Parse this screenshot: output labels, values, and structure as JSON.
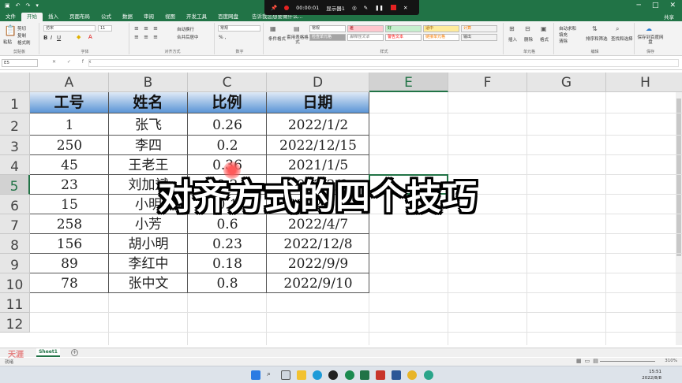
{
  "titlebar": {
    "window_controls": [
      "─",
      "□",
      "✕"
    ]
  },
  "recorder": {
    "time": "00:00:01",
    "display": "显示器1"
  },
  "menu": {
    "tabs": [
      "文件",
      "开始",
      "插入",
      "页面布局",
      "公式",
      "数据",
      "审阅",
      "视图",
      "开发工具",
      "百度网盘"
    ],
    "active_tab": "开始",
    "tell_me": "告诉我您想要做什么...",
    "share": "共享"
  },
  "ribbon": {
    "clipboard": {
      "paste": "粘贴",
      "cut": "剪切",
      "copy": "复制",
      "format_painter": "格式刷",
      "label": "剪贴板"
    },
    "font": {
      "name": "仿宋",
      "size": "11",
      "label": "字体"
    },
    "alignment": {
      "wrap": "自动换行",
      "merge": "合并后居中",
      "label": "对齐方式"
    },
    "number": {
      "format": "常规",
      "label": "数字"
    },
    "styles": {
      "conditional": "条件格式",
      "table": "套用表格格式",
      "cells": [
        "常规",
        "差",
        "好",
        "适中",
        "计算",
        "检查单元格",
        "解释性文本",
        "警告文本",
        "链接单元格",
        "输出"
      ],
      "label": "样式"
    },
    "cells_group": {
      "insert": "插入",
      "delete": "删除",
      "format": "格式",
      "label": "单元格"
    },
    "editing": {
      "autosum": "自动求和",
      "fill": "填充",
      "clear": "清除",
      "sort": "排序和筛选",
      "find": "查找和选择",
      "label": "编辑"
    },
    "save": {
      "label": "保存到百度网盘",
      "group": "保存"
    },
    "colors": {
      "accent": "#217346",
      "header_top": "#dfe9f6",
      "header_bottom": "#5b95d6",
      "good": "#c6efce",
      "bad": "#ffc7ce",
      "neutral": "#ffeb9c"
    }
  },
  "formula_bar": {
    "name_box": "E5",
    "fx_icons": "✕ ✓ fx",
    "value": ""
  },
  "grid": {
    "columns": [
      "A",
      "B",
      "C",
      "D",
      "E",
      "F",
      "G",
      "H"
    ],
    "rows": [
      "1",
      "2",
      "3",
      "4",
      "5",
      "6",
      "7",
      "8",
      "9",
      "10",
      "11",
      "12"
    ],
    "selected_cell": "E5",
    "table": {
      "headers": [
        "工号",
        "姓名",
        "比例",
        "日期"
      ],
      "rows": [
        [
          "1",
          "张飞",
          "0.26",
          "2022/1/2"
        ],
        [
          "250",
          "李四",
          "0.2",
          "2022/12/15"
        ],
        [
          "45",
          "王老王",
          "0.36",
          "2021/1/5"
        ],
        [
          "23",
          "刘加斌",
          "0.2",
          "2022/2/9"
        ],
        [
          "15",
          "小明",
          "0.1",
          "2022/9/6"
        ],
        [
          "258",
          "小芳",
          "0.6",
          "2022/4/7"
        ],
        [
          "156",
          "胡小明",
          "0.23",
          "2022/12/8"
        ],
        [
          "89",
          "李红中",
          "0.18",
          "2022/9/9"
        ],
        [
          "78",
          "张中文",
          "0.8",
          "2022/9/10"
        ]
      ]
    }
  },
  "overlay": {
    "caption": "对齐方式的四个技巧"
  },
  "sheets": {
    "tabs": [
      "Sheet1"
    ],
    "add": "+"
  },
  "watermark": "天涯",
  "status": {
    "ready": "就绪",
    "zoom": "310%"
  },
  "taskbar": {
    "time": "15:51",
    "date": "2022/8/8",
    "icons": [
      "windows-icon",
      "search-icon",
      "taskview-icon",
      "explorer-icon",
      "edge-icon",
      "qq-icon",
      "excel-icon",
      "wps-icon",
      "word-icon",
      "chrome-icon",
      "app-icon"
    ]
  }
}
